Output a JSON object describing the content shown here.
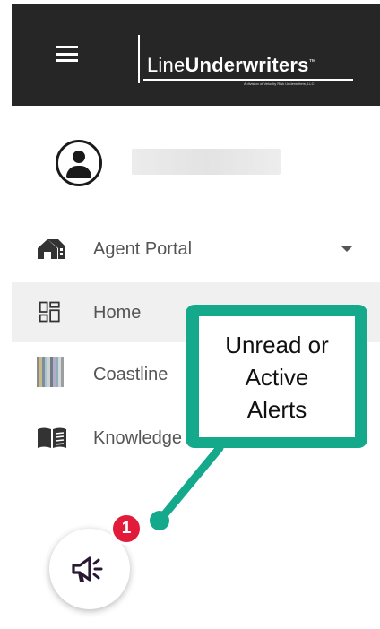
{
  "header": {
    "logo_prefix": "Line",
    "logo_bold": "Underwriters",
    "logo_mark": "™",
    "logo_tagline": "A division of Velocity Risk Underwriters, LLC",
    "background": "#262626"
  },
  "user": {
    "name_obscured": true
  },
  "menu": {
    "items": [
      {
        "label": "Agent Portal",
        "icon": "house-icon",
        "expandable": true
      },
      {
        "label": "Home",
        "icon": "dashboard-grid-icon",
        "active": true
      },
      {
        "label": "Coastline",
        "icon": "coastline-logo-icon"
      },
      {
        "label": "Knowledge",
        "icon": "book-icon"
      }
    ]
  },
  "alerts": {
    "count": "1",
    "icon": "megaphone-icon",
    "badge_color": "#e31b3b"
  },
  "callout": {
    "text": "Unread or\nActive\nAlerts",
    "color": "#14a98a"
  }
}
